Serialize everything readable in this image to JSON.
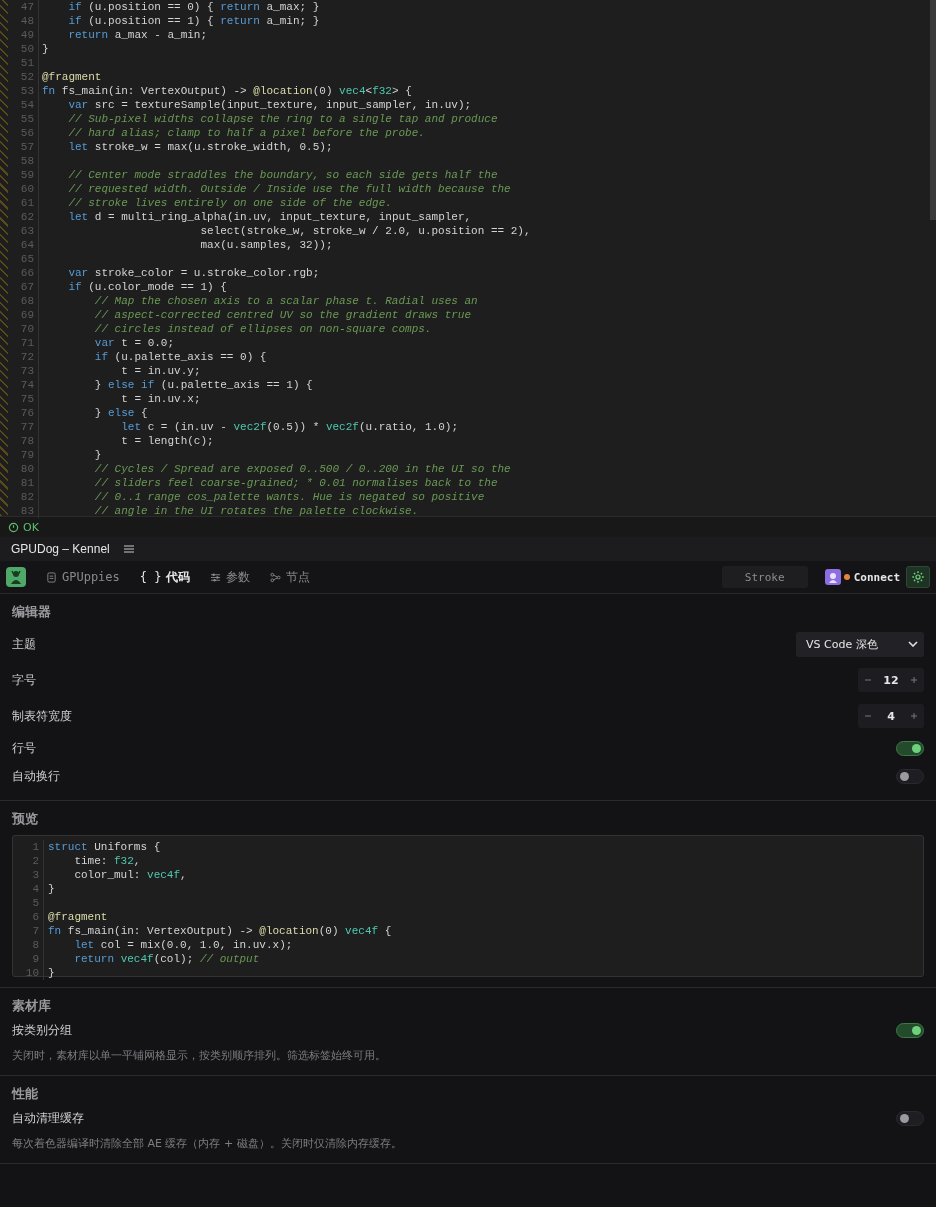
{
  "editor": {
    "lines": [
      {
        "number": "47",
        "text": "    if (u.position == 0) { return a_max; }"
      },
      {
        "number": "48",
        "text": "    if (u.position == 1) { return a_min; }"
      },
      {
        "number": "49",
        "text": "    return a_max - a_min;"
      },
      {
        "number": "50",
        "text": "}"
      },
      {
        "number": "51"
      },
      {
        "number": "52",
        "text": "@fragment"
      },
      {
        "number": "53",
        "text": "fn fs_main(in: VertexOutput) -> @location(0) vec4<f32> {"
      },
      {
        "number": "54",
        "text": "    var src = textureSample(input_texture, input_sampler, in.uv);"
      },
      {
        "number": "55",
        "text": "    // Sub-pixel widths collapse the ring to a single tap and produce"
      },
      {
        "number": "56",
        "text": "    // hard alias; clamp to half a pixel before the probe."
      },
      {
        "number": "57",
        "text": "    let stroke_w = max(u.stroke_width, 0.5);"
      },
      {
        "number": "58"
      },
      {
        "number": "59",
        "text": "    // Center mode straddles the boundary, so each side gets half the"
      },
      {
        "number": "60",
        "text": "    // requested width. Outside / Inside use the full width because the"
      },
      {
        "number": "61",
        "text": "    // stroke lives entirely on one side of the edge."
      },
      {
        "number": "62",
        "text": "    let d = multi_ring_alpha(in.uv, input_texture, input_sampler,"
      },
      {
        "number": "63",
        "text": "                        select(stroke_w, stroke_w / 2.0, u.position == 2),"
      },
      {
        "number": "64",
        "text": "                        max(u.samples, 32));"
      },
      {
        "number": "65"
      },
      {
        "number": "66",
        "text": "    var stroke_color = u.stroke_color.rgb;"
      },
      {
        "number": "67",
        "text": "    if (u.color_mode == 1) {"
      },
      {
        "number": "68",
        "text": "        // Map the chosen axis to a scalar phase t. Radial uses an"
      },
      {
        "number": "69",
        "text": "        // aspect-corrected centred UV so the gradient draws true"
      },
      {
        "number": "70",
        "text": "        // circles instead of ellipses on non-square comps."
      },
      {
        "number": "71",
        "text": "        var t = 0.0;"
      },
      {
        "number": "72",
        "text": "        if (u.palette_axis == 0) {"
      },
      {
        "number": "73",
        "text": "            t = in.uv.y;"
      },
      {
        "number": "74",
        "text": "        } else if (u.palette_axis == 1) {"
      },
      {
        "number": "75",
        "text": "            t = in.uv.x;"
      },
      {
        "number": "76",
        "text": "        } else {"
      },
      {
        "number": "77",
        "text": "            let c = (in.uv - vec2f(0.5)) * vec2f(u.ratio, 1.0);"
      },
      {
        "number": "78",
        "text": "            t = length(c);"
      },
      {
        "number": "79",
        "text": "        }"
      },
      {
        "number": "80",
        "text": "        // Cycles / Spread are exposed 0..500 / 0..200 in the UI so the"
      },
      {
        "number": "81",
        "text": "        // sliders feel coarse-grained; * 0.01 normalises back to the"
      },
      {
        "number": "82",
        "text": "        // 0..1 range cos_palette wants. Hue is negated so positive"
      },
      {
        "number": "83",
        "text": "        // angle in the UI rotates the palette clockwise."
      }
    ]
  },
  "status_bar": {
    "status": "OK"
  },
  "window": {
    "title": "GPUDog – Kennel"
  },
  "toolbar": {
    "tabs": [
      {
        "label": "GPUppies",
        "kind": "document",
        "selected": false
      },
      {
        "label": "代码",
        "kind": "braces",
        "icon_text": "{ }",
        "selected": true
      },
      {
        "label": "参数",
        "kind": "params",
        "selected": false
      },
      {
        "label": "节点",
        "kind": "nodes",
        "selected": false
      }
    ],
    "shader_name": "Stroke",
    "connect_label": "Connect",
    "connected": false
  },
  "sections": [
    {
      "title": "编辑器",
      "settings": [
        {
          "kind": "select",
          "label": "主题",
          "value": "VS Code 深色"
        },
        {
          "kind": "stepper",
          "label": "字号",
          "value": "12"
        },
        {
          "kind": "stepper",
          "label": "制表符宽度",
          "value": "4"
        },
        {
          "kind": "toggle",
          "label": "行号",
          "on": true
        },
        {
          "kind": "toggle",
          "label": "自动换行",
          "on": false
        }
      ]
    },
    {
      "title": "预览",
      "preview": [
        {
          "number": "1",
          "text": "struct Uniforms {"
        },
        {
          "number": "2",
          "text": "    time: f32,"
        },
        {
          "number": "3",
          "text": "    color_mul: vec4f,"
        },
        {
          "number": "4",
          "text": "}"
        },
        {
          "number": "5"
        },
        {
          "number": "6",
          "text": "@fragment"
        },
        {
          "number": "7",
          "text": "fn fs_main(in: VertexOutput) -> @location(0) vec4f {"
        },
        {
          "number": "8",
          "text": "    let col = mix(0.0, 1.0, in.uv.x);"
        },
        {
          "number": "9",
          "text": "    return vec4f(col); // output"
        },
        {
          "number": "10",
          "text": "}"
        }
      ]
    },
    {
      "title": "素材库",
      "settings": [
        {
          "kind": "toggle",
          "label": "按类别分组",
          "on": true,
          "description": "关闭时，素材库以单一平铺网格显示，按类别顺序排列。筛选标签始终可用。"
        }
      ]
    },
    {
      "title": "性能",
      "settings": [
        {
          "kind": "toggle",
          "label": "自动清理缓存",
          "on": false,
          "description": "每次着色器编译时清除全部 AE 缓存（内存 + 磁盘）。关闭时仅清除内存缓存。"
        }
      ]
    }
  ]
}
